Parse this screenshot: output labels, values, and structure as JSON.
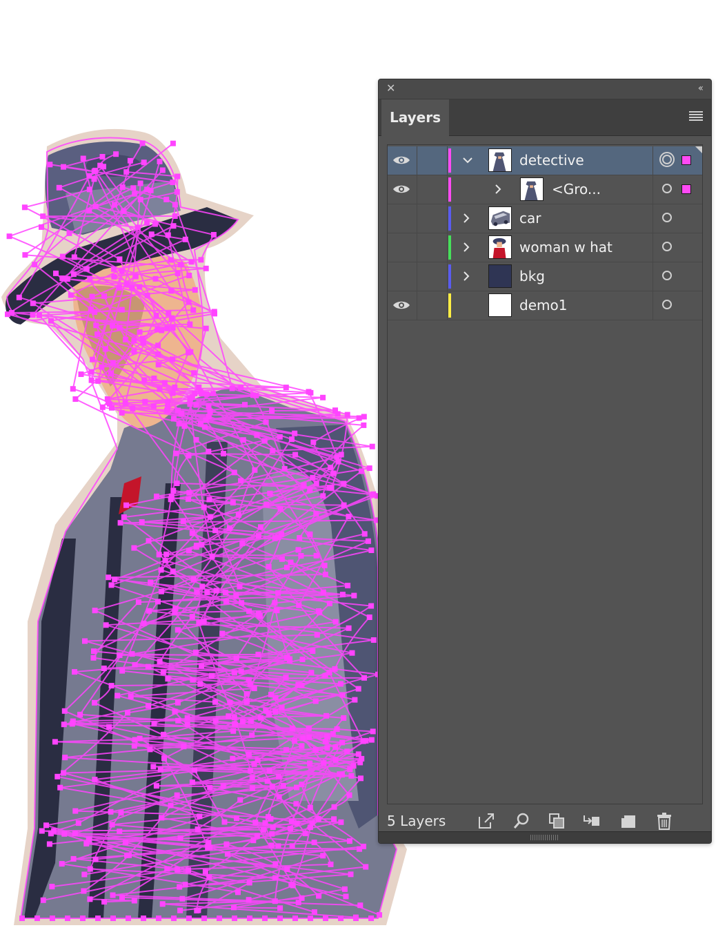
{
  "panel": {
    "tab_label": "Layers",
    "layer_count_label": "5 Layers"
  },
  "colors": {
    "detective": "#ff4af4",
    "car": "#5a5cf0",
    "woman_w_hat": "#46e05a",
    "bkg": "#5a5cf0",
    "demo1": "#ffee44",
    "selection_row": "#54677e",
    "panel_bg": "#535353",
    "path_anchor": "#ff44ff"
  },
  "layers": [
    {
      "name": "detective",
      "visible": true,
      "expanded": true,
      "selected": true,
      "has_selection": true,
      "thumb": "detective-thumb"
    },
    {
      "name": "<Gro...",
      "visible": true,
      "expanded": false,
      "sublayer": true,
      "has_selection": true,
      "thumb": "group-thumb"
    },
    {
      "name": "car",
      "visible": false,
      "expanded": false,
      "thumb": "car-thumb"
    },
    {
      "name": "woman w hat",
      "visible": false,
      "expanded": false,
      "thumb": "woman-thumb"
    },
    {
      "name": "bkg",
      "visible": false,
      "expanded": false,
      "thumb": "bkg-thumb"
    },
    {
      "name": "demo1",
      "visible": true,
      "expanded": false,
      "thumb": "blank-thumb"
    }
  ],
  "footer_icons": [
    "collect-for-export-icon",
    "locate-object-icon",
    "clipping-mask-icon",
    "sublayer-icon",
    "new-layer-icon",
    "trash-icon"
  ]
}
